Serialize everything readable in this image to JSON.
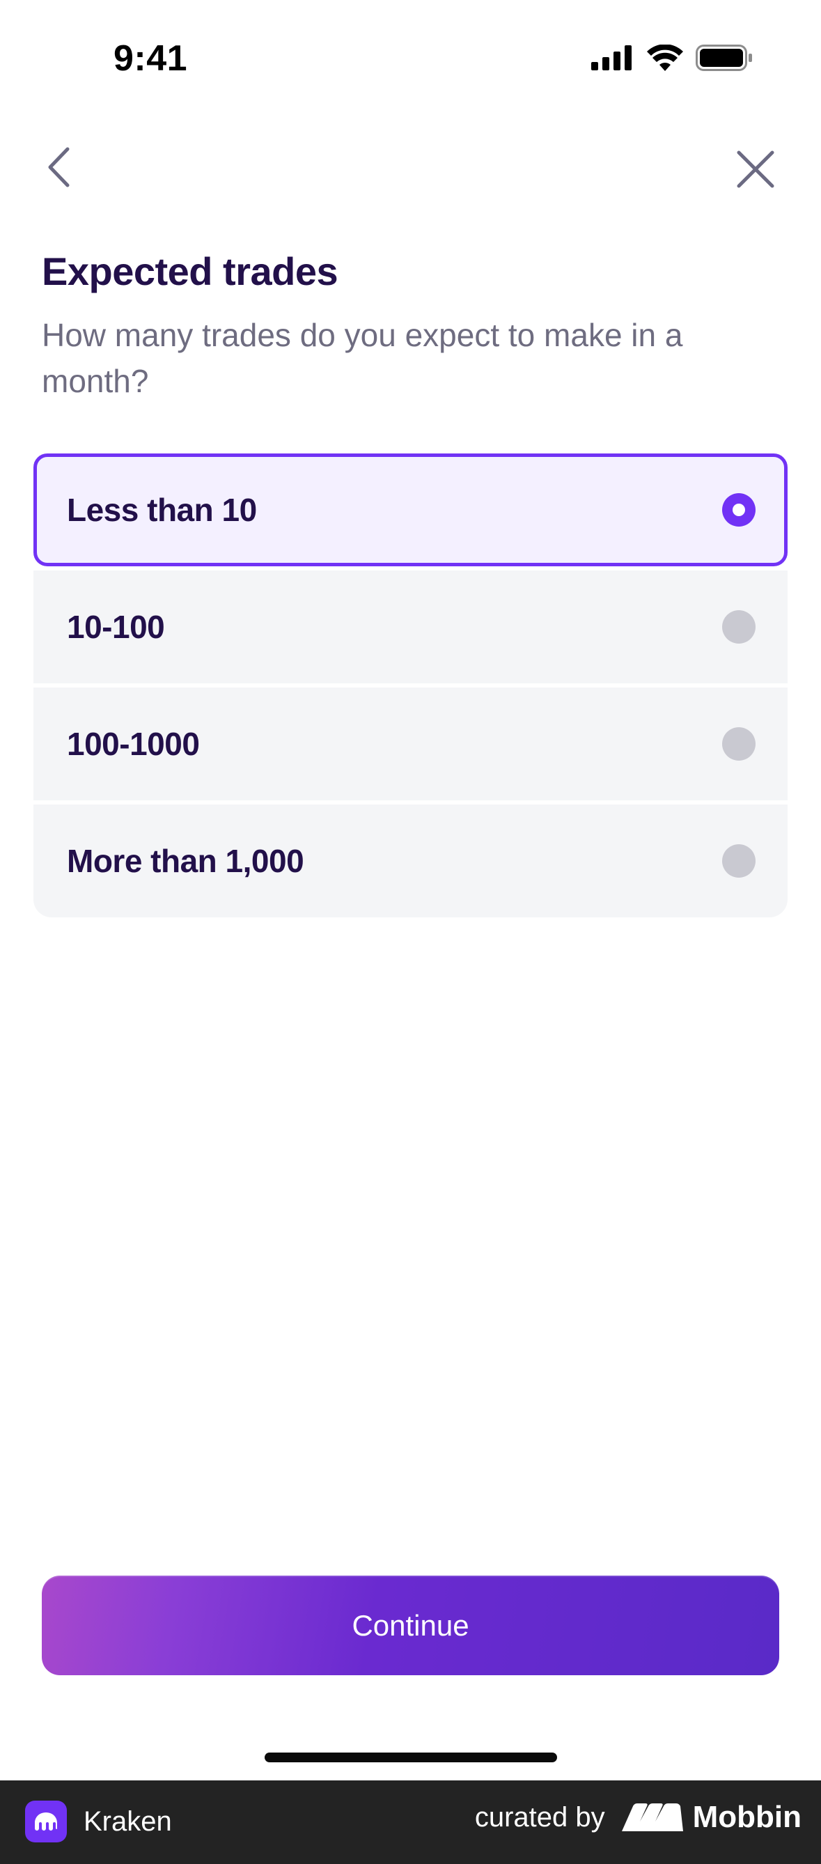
{
  "status_bar": {
    "time": "9:41"
  },
  "nav": {
    "back_icon": "chevron-left-icon",
    "close_icon": "close-icon"
  },
  "header": {
    "title": "Expected trades",
    "subtitle": "How many trades do you expect to make in a month?"
  },
  "options": [
    {
      "label": "Less than 10",
      "selected": true
    },
    {
      "label": "10-100",
      "selected": false
    },
    {
      "label": "100-1000",
      "selected": false
    },
    {
      "label": "More than 1,000",
      "selected": false
    }
  ],
  "actions": {
    "continue_label": "Continue"
  },
  "footer": {
    "app_name": "Kraken",
    "curated_by": "curated by",
    "brand": "Mobbin"
  },
  "colors": {
    "accent": "#7132f5",
    "title": "#22104a",
    "subtitle": "#6e6c80",
    "option_bg": "#f4f5f7",
    "selected_bg": "#f4f0ff",
    "radio_unselected": "#c9c9d1",
    "footer_bg": "#232323"
  }
}
